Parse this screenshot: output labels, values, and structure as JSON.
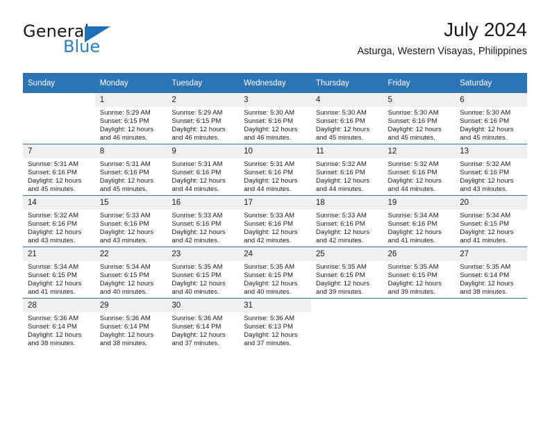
{
  "brand": {
    "name_top": "General",
    "name_bottom": "Blue",
    "triangle_color": "#1f6fb8",
    "blue_color": "#2a7ec1"
  },
  "header": {
    "title": "July 2024",
    "subtitle": "Asturga, Western Visayas, Philippines"
  },
  "theme": {
    "header_bg": "#2d74b5",
    "header_text": "#ffffff",
    "daynum_bg": "#f0f0f0",
    "grid_line": "#2d74b5"
  },
  "weekday_headers": [
    "Sunday",
    "Monday",
    "Tuesday",
    "Wednesday",
    "Thursday",
    "Friday",
    "Saturday"
  ],
  "labels": {
    "sunrise_prefix": "Sunrise:",
    "sunset_prefix": "Sunset:",
    "daylight_prefix": "Daylight:"
  },
  "weeks": [
    [
      {
        "day": "",
        "line1": "",
        "line2": "",
        "line3": "",
        "line4": ""
      },
      {
        "day": "1",
        "line1": "Sunrise: 5:29 AM",
        "line2": "Sunset: 6:15 PM",
        "line3": "Daylight: 12 hours",
        "line4": "and 46 minutes."
      },
      {
        "day": "2",
        "line1": "Sunrise: 5:29 AM",
        "line2": "Sunset: 6:15 PM",
        "line3": "Daylight: 12 hours",
        "line4": "and 46 minutes."
      },
      {
        "day": "3",
        "line1": "Sunrise: 5:30 AM",
        "line2": "Sunset: 6:16 PM",
        "line3": "Daylight: 12 hours",
        "line4": "and 46 minutes."
      },
      {
        "day": "4",
        "line1": "Sunrise: 5:30 AM",
        "line2": "Sunset: 6:16 PM",
        "line3": "Daylight: 12 hours",
        "line4": "and 45 minutes."
      },
      {
        "day": "5",
        "line1": "Sunrise: 5:30 AM",
        "line2": "Sunset: 6:16 PM",
        "line3": "Daylight: 12 hours",
        "line4": "and 45 minutes."
      },
      {
        "day": "6",
        "line1": "Sunrise: 5:30 AM",
        "line2": "Sunset: 6:16 PM",
        "line3": "Daylight: 12 hours",
        "line4": "and 45 minutes."
      }
    ],
    [
      {
        "day": "7",
        "line1": "Sunrise: 5:31 AM",
        "line2": "Sunset: 6:16 PM",
        "line3": "Daylight: 12 hours",
        "line4": "and 45 minutes."
      },
      {
        "day": "8",
        "line1": "Sunrise: 5:31 AM",
        "line2": "Sunset: 6:16 PM",
        "line3": "Daylight: 12 hours",
        "line4": "and 45 minutes."
      },
      {
        "day": "9",
        "line1": "Sunrise: 5:31 AM",
        "line2": "Sunset: 6:16 PM",
        "line3": "Daylight: 12 hours",
        "line4": "and 44 minutes."
      },
      {
        "day": "10",
        "line1": "Sunrise: 5:31 AM",
        "line2": "Sunset: 6:16 PM",
        "line3": "Daylight: 12 hours",
        "line4": "and 44 minutes."
      },
      {
        "day": "11",
        "line1": "Sunrise: 5:32 AM",
        "line2": "Sunset: 6:16 PM",
        "line3": "Daylight: 12 hours",
        "line4": "and 44 minutes."
      },
      {
        "day": "12",
        "line1": "Sunrise: 5:32 AM",
        "line2": "Sunset: 6:16 PM",
        "line3": "Daylight: 12 hours",
        "line4": "and 44 minutes."
      },
      {
        "day": "13",
        "line1": "Sunrise: 5:32 AM",
        "line2": "Sunset: 6:16 PM",
        "line3": "Daylight: 12 hours",
        "line4": "and 43 minutes."
      }
    ],
    [
      {
        "day": "14",
        "line1": "Sunrise: 5:32 AM",
        "line2": "Sunset: 6:16 PM",
        "line3": "Daylight: 12 hours",
        "line4": "and 43 minutes."
      },
      {
        "day": "15",
        "line1": "Sunrise: 5:33 AM",
        "line2": "Sunset: 6:16 PM",
        "line3": "Daylight: 12 hours",
        "line4": "and 43 minutes."
      },
      {
        "day": "16",
        "line1": "Sunrise: 5:33 AM",
        "line2": "Sunset: 6:16 PM",
        "line3": "Daylight: 12 hours",
        "line4": "and 42 minutes."
      },
      {
        "day": "17",
        "line1": "Sunrise: 5:33 AM",
        "line2": "Sunset: 6:16 PM",
        "line3": "Daylight: 12 hours",
        "line4": "and 42 minutes."
      },
      {
        "day": "18",
        "line1": "Sunrise: 5:33 AM",
        "line2": "Sunset: 6:16 PM",
        "line3": "Daylight: 12 hours",
        "line4": "and 42 minutes."
      },
      {
        "day": "19",
        "line1": "Sunrise: 5:34 AM",
        "line2": "Sunset: 6:16 PM",
        "line3": "Daylight: 12 hours",
        "line4": "and 41 minutes."
      },
      {
        "day": "20",
        "line1": "Sunrise: 5:34 AM",
        "line2": "Sunset: 6:15 PM",
        "line3": "Daylight: 12 hours",
        "line4": "and 41 minutes."
      }
    ],
    [
      {
        "day": "21",
        "line1": "Sunrise: 5:34 AM",
        "line2": "Sunset: 6:15 PM",
        "line3": "Daylight: 12 hours",
        "line4": "and 41 minutes."
      },
      {
        "day": "22",
        "line1": "Sunrise: 5:34 AM",
        "line2": "Sunset: 6:15 PM",
        "line3": "Daylight: 12 hours",
        "line4": "and 40 minutes."
      },
      {
        "day": "23",
        "line1": "Sunrise: 5:35 AM",
        "line2": "Sunset: 6:15 PM",
        "line3": "Daylight: 12 hours",
        "line4": "and 40 minutes."
      },
      {
        "day": "24",
        "line1": "Sunrise: 5:35 AM",
        "line2": "Sunset: 6:15 PM",
        "line3": "Daylight: 12 hours",
        "line4": "and 40 minutes."
      },
      {
        "day": "25",
        "line1": "Sunrise: 5:35 AM",
        "line2": "Sunset: 6:15 PM",
        "line3": "Daylight: 12 hours",
        "line4": "and 39 minutes."
      },
      {
        "day": "26",
        "line1": "Sunrise: 5:35 AM",
        "line2": "Sunset: 6:15 PM",
        "line3": "Daylight: 12 hours",
        "line4": "and 39 minutes."
      },
      {
        "day": "27",
        "line1": "Sunrise: 5:35 AM",
        "line2": "Sunset: 6:14 PM",
        "line3": "Daylight: 12 hours",
        "line4": "and 38 minutes."
      }
    ],
    [
      {
        "day": "28",
        "line1": "Sunrise: 5:36 AM",
        "line2": "Sunset: 6:14 PM",
        "line3": "Daylight: 12 hours",
        "line4": "and 38 minutes."
      },
      {
        "day": "29",
        "line1": "Sunrise: 5:36 AM",
        "line2": "Sunset: 6:14 PM",
        "line3": "Daylight: 12 hours",
        "line4": "and 38 minutes."
      },
      {
        "day": "30",
        "line1": "Sunrise: 5:36 AM",
        "line2": "Sunset: 6:14 PM",
        "line3": "Daylight: 12 hours",
        "line4": "and 37 minutes."
      },
      {
        "day": "31",
        "line1": "Sunrise: 5:36 AM",
        "line2": "Sunset: 6:13 PM",
        "line3": "Daylight: 12 hours",
        "line4": "and 37 minutes."
      },
      {
        "day": "",
        "line1": "",
        "line2": "",
        "line3": "",
        "line4": ""
      },
      {
        "day": "",
        "line1": "",
        "line2": "",
        "line3": "",
        "line4": ""
      },
      {
        "day": "",
        "line1": "",
        "line2": "",
        "line3": "",
        "line4": ""
      }
    ]
  ]
}
